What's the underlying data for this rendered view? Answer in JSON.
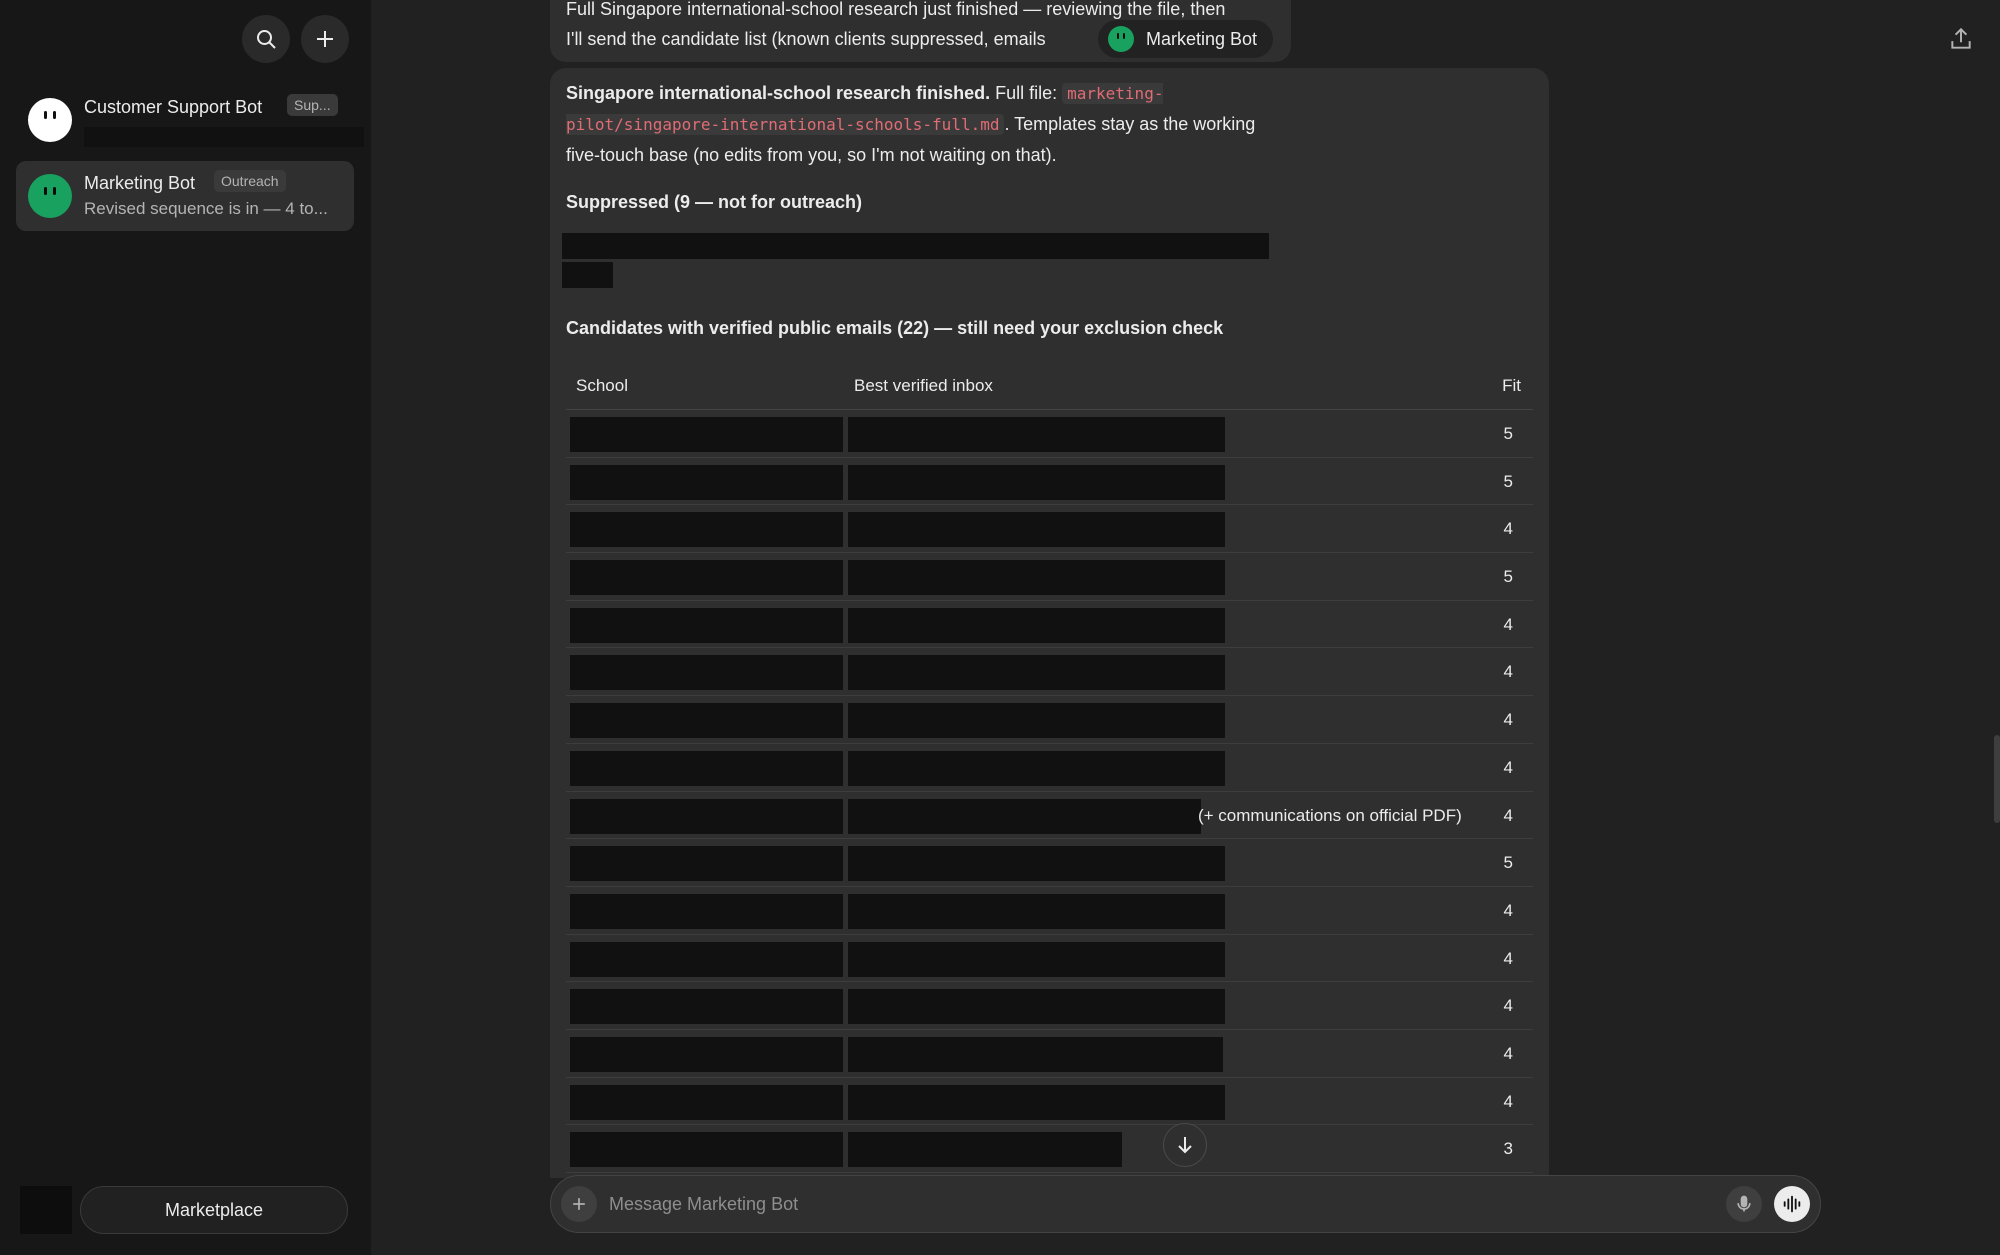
{
  "sidebar": {
    "chats": [
      {
        "name": "Customer Support Bot",
        "tag": "Sup...",
        "preview": "",
        "avatar_color": "#ffffff"
      },
      {
        "name": "Marketing Bot",
        "tag": "Outreach",
        "preview": "Revised sequence is in — 4 to...",
        "avatar_color": "#19a15f"
      }
    ],
    "marketplace_label": "Marketplace"
  },
  "conversation": {
    "previous_message": {
      "line1": "Full Singapore international-school research just finished — reviewing the file, then",
      "line2": "I'll send the candidate list (known clients suppressed, emails"
    },
    "bot_chip_label": "Marketing Bot",
    "message": {
      "intro_bold": "Singapore international-school research finished.",
      "intro_rest": " Full file: ",
      "file_path": "marketing-pilot/singapore-international-schools-full.md",
      "intro_tail": ". Templates stay as the working five-touch base (no edits from you, so I'm not waiting on that).",
      "suppressed_title": "Suppressed (9 — not for outreach)",
      "candidates_title": "Candidates with verified public emails (22) — still need your exclusion check",
      "table": {
        "headers": [
          "School",
          "Best verified inbox",
          "Fit"
        ],
        "rows": [
          {
            "fit": "5",
            "note": ""
          },
          {
            "fit": "5",
            "note": ""
          },
          {
            "fit": "4",
            "note": ""
          },
          {
            "fit": "5",
            "note": ""
          },
          {
            "fit": "4",
            "note": ""
          },
          {
            "fit": "4",
            "note": ""
          },
          {
            "fit": "4",
            "note": ""
          },
          {
            "fit": "4",
            "note": ""
          },
          {
            "fit": "4",
            "note": "(+ communications on official PDF)"
          },
          {
            "fit": "5",
            "note": ""
          },
          {
            "fit": "4",
            "note": ""
          },
          {
            "fit": "4",
            "note": ""
          },
          {
            "fit": "4",
            "note": ""
          },
          {
            "fit": "4",
            "note": ""
          },
          {
            "fit": "4",
            "note": ""
          },
          {
            "fit": "3",
            "note": ""
          }
        ]
      }
    }
  },
  "composer": {
    "placeholder": "Message Marketing Bot"
  },
  "icons": [
    "search-icon",
    "plus-icon",
    "share-icon",
    "arrow-down-icon",
    "mic-icon",
    "voice-mode-icon"
  ],
  "colors": {
    "accent_green": "#19a15f",
    "code_text": "#e06c75",
    "background": "#212121",
    "sidebar": "#171717"
  }
}
